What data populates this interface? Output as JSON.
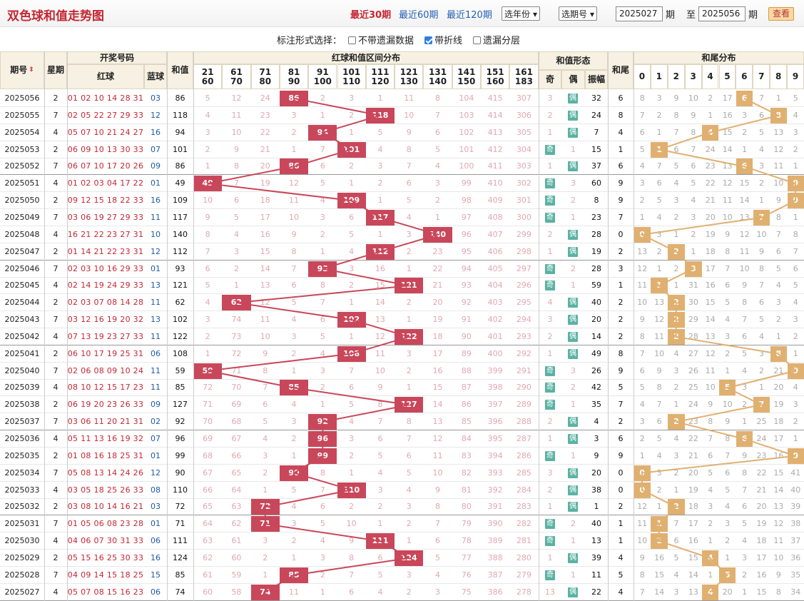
{
  "header": {
    "title": "双色球和值走势图",
    "periods": [
      "最近30期",
      "最近60期",
      "最近120期"
    ],
    "active_period": 0,
    "year_select": "选年份",
    "issue_select": "选期号",
    "from_issue": "2025027",
    "issue_unit": "期",
    "to_label": "至",
    "to_issue": "2025056",
    "query_button": "查看"
  },
  "options": {
    "label": "标注形式选择：",
    "items": [
      {
        "label": "不带遗漏数据",
        "checked": false
      },
      {
        "label": "带折线",
        "checked": true
      },
      {
        "label": "遗漏分层",
        "checked": false
      }
    ]
  },
  "table_header": {
    "period": "期号",
    "week": "星期",
    "draw": "开奖号码",
    "red": "红球",
    "blue": "蓝球",
    "sum": "和值",
    "zone_title": "红球和值区间分布",
    "zones": [
      [
        "21",
        "60"
      ],
      [
        "61",
        "70"
      ],
      [
        "71",
        "80"
      ],
      [
        "81",
        "90"
      ],
      [
        "91",
        "100"
      ],
      [
        "101",
        "110"
      ],
      [
        "111",
        "120"
      ],
      [
        "121",
        "130"
      ],
      [
        "131",
        "140"
      ],
      [
        "141",
        "150"
      ],
      [
        "151",
        "160"
      ],
      [
        "161",
        "183"
      ]
    ],
    "form_title": "和值形态",
    "odd": "奇",
    "even": "偶",
    "amplitude": "振幅",
    "tail_title": "和尾",
    "tail_dist": "和尾分布",
    "tails": [
      "0",
      "1",
      "2",
      "3",
      "4",
      "5",
      "6",
      "7",
      "8",
      "9"
    ]
  },
  "rows": [
    {
      "p": "2025056",
      "w": "2",
      "r": "01 02 10 14 28 31",
      "b": "03",
      "s": "86",
      "zone": 3,
      "zv": [
        "5",
        "12",
        "24",
        "86",
        "2",
        "3",
        "1",
        "11",
        "8",
        "104",
        "415",
        "307"
      ],
      "odd": "3",
      "even": "偶",
      "form": "even",
      "amp": "32",
      "tail": "6",
      "tv": [
        "8",
        "3",
        "9",
        "10",
        "2",
        "17",
        "6",
        "7",
        "1",
        "5"
      ]
    },
    {
      "p": "2025055",
      "w": "7",
      "r": "02 05 22 27 29 33",
      "b": "12",
      "s": "118",
      "zone": 6,
      "zv": [
        "4",
        "11",
        "23",
        "3",
        "1",
        "2",
        "118",
        "10",
        "7",
        "103",
        "414",
        "306"
      ],
      "odd": "2",
      "even": "偶",
      "form": "even",
      "amp": "24",
      "tail": "8",
      "tv": [
        "7",
        "2",
        "8",
        "9",
        "1",
        "16",
        "3",
        "6",
        "8",
        "4"
      ]
    },
    {
      "p": "2025054",
      "w": "4",
      "r": "05 07 10 21 24 27",
      "b": "16",
      "s": "94",
      "zone": 4,
      "zv": [
        "3",
        "10",
        "22",
        "2",
        "94",
        "1",
        "5",
        "9",
        "6",
        "102",
        "413",
        "305"
      ],
      "odd": "1",
      "even": "偶",
      "form": "even",
      "amp": "7",
      "tail": "4",
      "tv": [
        "6",
        "1",
        "7",
        "8",
        "4",
        "15",
        "2",
        "5",
        "13",
        "3"
      ]
    },
    {
      "p": "2025053",
      "w": "2",
      "r": "06 09 10 13 30 33",
      "b": "07",
      "s": "101",
      "zone": 5,
      "zv": [
        "2",
        "9",
        "21",
        "1",
        "7",
        "101",
        "4",
        "8",
        "5",
        "101",
        "412",
        "304"
      ],
      "odd": "奇",
      "even": "1",
      "form": "odd",
      "amp": "15",
      "tail": "1",
      "tv": [
        "5",
        "1",
        "6",
        "7",
        "24",
        "14",
        "1",
        "4",
        "12",
        "2"
      ]
    },
    {
      "p": "2025052",
      "w": "7",
      "r": "06 07 10 17 20 26",
      "b": "09",
      "s": "86",
      "zone": 3,
      "zv": [
        "1",
        "8",
        "20",
        "86",
        "6",
        "2",
        "3",
        "7",
        "4",
        "100",
        "411",
        "303"
      ],
      "odd": "1",
      "even": "偶",
      "form": "even",
      "amp": "37",
      "tail": "6",
      "tv": [
        "4",
        "7",
        "5",
        "6",
        "23",
        "13",
        "6",
        "3",
        "11",
        "1"
      ]
    },
    {
      "p": "2025051",
      "w": "4",
      "r": "01 02 03 04 17 22",
      "b": "01",
      "s": "49",
      "zone": 0,
      "zv": [
        "49",
        "7",
        "19",
        "12",
        "5",
        "1",
        "2",
        "6",
        "3",
        "99",
        "410",
        "302"
      ],
      "odd": "奇",
      "even": "3",
      "form": "odd",
      "amp": "60",
      "tail": "9",
      "tv": [
        "3",
        "6",
        "4",
        "5",
        "22",
        "12",
        "15",
        "2",
        "10",
        "9"
      ]
    },
    {
      "p": "2025050",
      "w": "2",
      "r": "09 12 15 18 22 33",
      "b": "16",
      "s": "109",
      "zone": 5,
      "zv": [
        "10",
        "6",
        "18",
        "11",
        "4",
        "109",
        "1",
        "5",
        "2",
        "98",
        "409",
        "301"
      ],
      "odd": "奇",
      "even": "2",
      "form": "odd",
      "amp": "8",
      "tail": "9",
      "tv": [
        "2",
        "5",
        "3",
        "4",
        "21",
        "11",
        "14",
        "1",
        "9",
        "9"
      ]
    },
    {
      "p": "2025049",
      "w": "7",
      "r": "03 06 19 27 29 33",
      "b": "11",
      "s": "117",
      "zone": 6,
      "zv": [
        "9",
        "5",
        "17",
        "10",
        "3",
        "6",
        "117",
        "4",
        "1",
        "97",
        "408",
        "300"
      ],
      "odd": "奇",
      "even": "1",
      "form": "odd",
      "amp": "23",
      "tail": "7",
      "tv": [
        "1",
        "4",
        "2",
        "3",
        "20",
        "10",
        "13",
        "7",
        "8",
        "1"
      ]
    },
    {
      "p": "2025048",
      "w": "4",
      "r": "16 21 22 23 27 31",
      "b": "10",
      "s": "140",
      "zone": 8,
      "zv": [
        "8",
        "4",
        "16",
        "9",
        "2",
        "5",
        "1",
        "3",
        "140",
        "96",
        "407",
        "299"
      ],
      "odd": "2",
      "even": "偶",
      "form": "even",
      "amp": "28",
      "tail": "0",
      "tv": [
        "0",
        "3",
        "1",
        "2",
        "19",
        "9",
        "12",
        "10",
        "7",
        "8"
      ]
    },
    {
      "p": "2025047",
      "w": "2",
      "r": "01 14 21 22 23 31",
      "b": "12",
      "s": "112",
      "zone": 6,
      "zv": [
        "7",
        "3",
        "15",
        "8",
        "1",
        "4",
        "112",
        "2",
        "23",
        "95",
        "406",
        "298"
      ],
      "odd": "1",
      "even": "偶",
      "form": "even",
      "amp": "19",
      "tail": "2",
      "tv": [
        "13",
        "2",
        "2",
        "1",
        "18",
        "8",
        "11",
        "9",
        "6",
        "7"
      ]
    },
    {
      "p": "2025046",
      "w": "7",
      "r": "02 03 10 16 29 33",
      "b": "01",
      "s": "93",
      "zone": 4,
      "zv": [
        "6",
        "2",
        "14",
        "7",
        "93",
        "3",
        "16",
        "1",
        "22",
        "94",
        "405",
        "297"
      ],
      "odd": "奇",
      "even": "2",
      "form": "odd",
      "amp": "28",
      "tail": "3",
      "tv": [
        "12",
        "1",
        "2",
        "3",
        "17",
        "7",
        "10",
        "8",
        "5",
        "6"
      ]
    },
    {
      "p": "2025045",
      "w": "4",
      "r": "02 14 19 24 29 33",
      "b": "13",
      "s": "121",
      "zone": 7,
      "zv": [
        "5",
        "1",
        "13",
        "6",
        "8",
        "2",
        "15",
        "121",
        "21",
        "93",
        "404",
        "296"
      ],
      "odd": "奇",
      "even": "1",
      "form": "odd",
      "amp": "59",
      "tail": "1",
      "tv": [
        "11",
        "1",
        "1",
        "31",
        "16",
        "6",
        "9",
        "7",
        "4",
        "5"
      ]
    },
    {
      "p": "2025044",
      "w": "2",
      "r": "02 03 07 08 14 28",
      "b": "11",
      "s": "62",
      "zone": 1,
      "zv": [
        "4",
        "62",
        "12",
        "5",
        "7",
        "1",
        "14",
        "2",
        "20",
        "92",
        "403",
        "295"
      ],
      "odd": "4",
      "even": "偶",
      "form": "even",
      "amp": "40",
      "tail": "2",
      "tv": [
        "10",
        "13",
        "2",
        "30",
        "15",
        "5",
        "8",
        "6",
        "3",
        "4"
      ]
    },
    {
      "p": "2025043",
      "w": "7",
      "r": "03 12 16 19 20 32",
      "b": "13",
      "s": "102",
      "zone": 5,
      "zv": [
        "3",
        "74",
        "11",
        "4",
        "6",
        "102",
        "13",
        "1",
        "19",
        "91",
        "402",
        "294"
      ],
      "odd": "3",
      "even": "偶",
      "form": "even",
      "amp": "20",
      "tail": "2",
      "tv": [
        "9",
        "12",
        "2",
        "29",
        "14",
        "4",
        "7",
        "5",
        "2",
        "3"
      ]
    },
    {
      "p": "2025042",
      "w": "4",
      "r": "07 13 19 23 27 33",
      "b": "11",
      "s": "122",
      "zone": 7,
      "zv": [
        "2",
        "73",
        "10",
        "3",
        "5",
        "1",
        "12",
        "122",
        "18",
        "90",
        "401",
        "293"
      ],
      "odd": "2",
      "even": "偶",
      "form": "even",
      "amp": "14",
      "tail": "2",
      "tv": [
        "8",
        "11",
        "2",
        "28",
        "13",
        "3",
        "6",
        "4",
        "1",
        "2"
      ]
    },
    {
      "p": "2025041",
      "w": "2",
      "r": "06 10 17 19 25 31",
      "b": "06",
      "s": "108",
      "zone": 5,
      "zv": [
        "1",
        "72",
        "9",
        "2",
        "4",
        "108",
        "11",
        "3",
        "17",
        "89",
        "400",
        "292"
      ],
      "odd": "1",
      "even": "偶",
      "form": "even",
      "amp": "49",
      "tail": "8",
      "tv": [
        "7",
        "10",
        "4",
        "27",
        "12",
        "2",
        "5",
        "3",
        "8",
        "1"
      ]
    },
    {
      "p": "2025040",
      "w": "7",
      "r": "02 06 08 09 10 24",
      "b": "11",
      "s": "59",
      "zone": 0,
      "zv": [
        "59",
        "71",
        "8",
        "1",
        "3",
        "7",
        "10",
        "2",
        "16",
        "88",
        "399",
        "291"
      ],
      "odd": "奇",
      "even": "3",
      "form": "odd",
      "amp": "26",
      "tail": "9",
      "tv": [
        "6",
        "9",
        "3",
        "26",
        "11",
        "1",
        "4",
        "2",
        "21",
        "9"
      ]
    },
    {
      "p": "2025039",
      "w": "4",
      "r": "08 10 12 15 17 23",
      "b": "11",
      "s": "85",
      "zone": 3,
      "zv": [
        "72",
        "70",
        "7",
        "85",
        "2",
        "6",
        "9",
        "1",
        "15",
        "87",
        "398",
        "290"
      ],
      "odd": "奇",
      "even": "2",
      "form": "odd",
      "amp": "42",
      "tail": "5",
      "tv": [
        "5",
        "8",
        "2",
        "25",
        "10",
        "5",
        "3",
        "1",
        "20",
        "4"
      ]
    },
    {
      "p": "2025038",
      "w": "2",
      "r": "06 19 20 23 26 33",
      "b": "09",
      "s": "127",
      "zone": 7,
      "zv": [
        "71",
        "69",
        "6",
        "4",
        "1",
        "5",
        "8",
        "127",
        "14",
        "86",
        "397",
        "289"
      ],
      "odd": "奇",
      "even": "1",
      "form": "odd",
      "amp": "35",
      "tail": "7",
      "tv": [
        "4",
        "7",
        "1",
        "24",
        "9",
        "10",
        "2",
        "7",
        "19",
        "3"
      ]
    },
    {
      "p": "2025037",
      "w": "7",
      "r": "03 06 11 20 21 31",
      "b": "02",
      "s": "92",
      "zone": 4,
      "zv": [
        "70",
        "68",
        "5",
        "3",
        "92",
        "4",
        "7",
        "8",
        "13",
        "85",
        "396",
        "288"
      ],
      "odd": "2",
      "even": "偶",
      "form": "even",
      "amp": "4",
      "tail": "2",
      "tv": [
        "3",
        "6",
        "2",
        "23",
        "8",
        "9",
        "1",
        "25",
        "18",
        "2"
      ]
    },
    {
      "p": "2025036",
      "w": "4",
      "r": "05 11 13 16 19 32",
      "b": "07",
      "s": "96",
      "zone": 4,
      "zv": [
        "69",
        "67",
        "4",
        "2",
        "96",
        "3",
        "6",
        "7",
        "12",
        "84",
        "395",
        "287"
      ],
      "odd": "1",
      "even": "偶",
      "form": "even",
      "amp": "3",
      "tail": "6",
      "tv": [
        "2",
        "5",
        "4",
        "22",
        "7",
        "8",
        "6",
        "24",
        "17",
        "1"
      ]
    },
    {
      "p": "2025035",
      "w": "2",
      "r": "01 08 16 18 25 31",
      "b": "01",
      "s": "99",
      "zone": 4,
      "zv": [
        "68",
        "66",
        "3",
        "1",
        "99",
        "2",
        "5",
        "6",
        "11",
        "83",
        "394",
        "286"
      ],
      "odd": "奇",
      "even": "1",
      "form": "odd",
      "amp": "9",
      "tail": "9",
      "tv": [
        "1",
        "4",
        "3",
        "21",
        "6",
        "7",
        "9",
        "23",
        "16",
        "9"
      ]
    },
    {
      "p": "2025034",
      "w": "7",
      "r": "05 08 13 14 24 26",
      "b": "12",
      "s": "90",
      "zone": 3,
      "zv": [
        "67",
        "65",
        "2",
        "90",
        "8",
        "1",
        "4",
        "5",
        "10",
        "82",
        "393",
        "285"
      ],
      "odd": "3",
      "even": "偶",
      "form": "even",
      "amp": "20",
      "tail": "0",
      "tv": [
        "0",
        "3",
        "2",
        "20",
        "5",
        "6",
        "8",
        "22",
        "15",
        "41"
      ]
    },
    {
      "p": "2025033",
      "w": "4",
      "r": "03 05 18 25 26 33",
      "b": "08",
      "s": "110",
      "zone": 5,
      "zv": [
        "66",
        "64",
        "1",
        "5",
        "7",
        "110",
        "3",
        "4",
        "9",
        "81",
        "392",
        "284"
      ],
      "odd": "2",
      "even": "偶",
      "form": "even",
      "amp": "38",
      "tail": "0",
      "tv": [
        "0",
        "2",
        "1",
        "19",
        "4",
        "5",
        "7",
        "21",
        "14",
        "40"
      ]
    },
    {
      "p": "2025032",
      "w": "2",
      "r": "03 08 10 14 16 21",
      "b": "03",
      "s": "72",
      "zone": 2,
      "zv": [
        "65",
        "63",
        "72",
        "4",
        "6",
        "2",
        "2",
        "3",
        "8",
        "80",
        "391",
        "283"
      ],
      "odd": "1",
      "even": "偶",
      "form": "even",
      "amp": "1",
      "tail": "2",
      "tv": [
        "12",
        "1",
        "2",
        "18",
        "3",
        "4",
        "6",
        "20",
        "13",
        "39"
      ]
    },
    {
      "p": "2025031",
      "w": "7",
      "r": "01 05 06 08 23 28",
      "b": "01",
      "s": "71",
      "zone": 2,
      "zv": [
        "64",
        "62",
        "71",
        "3",
        "5",
        "10",
        "1",
        "2",
        "7",
        "79",
        "390",
        "282"
      ],
      "odd": "奇",
      "even": "2",
      "form": "odd",
      "amp": "40",
      "tail": "1",
      "tv": [
        "11",
        "1",
        "7",
        "17",
        "2",
        "3",
        "5",
        "19",
        "12",
        "38"
      ]
    },
    {
      "p": "2025030",
      "w": "4",
      "r": "04 06 07 30 31 33",
      "b": "06",
      "s": "111",
      "zone": 6,
      "zv": [
        "63",
        "61",
        "3",
        "2",
        "4",
        "9",
        "111",
        "1",
        "6",
        "78",
        "389",
        "281"
      ],
      "odd": "奇",
      "even": "1",
      "form": "odd",
      "amp": "13",
      "tail": "1",
      "tv": [
        "10",
        "1",
        "6",
        "16",
        "1",
        "2",
        "4",
        "18",
        "11",
        "37"
      ]
    },
    {
      "p": "2025029",
      "w": "2",
      "r": "05 15 16 25 30 33",
      "b": "16",
      "s": "124",
      "zone": 7,
      "zv": [
        "62",
        "60",
        "2",
        "1",
        "3",
        "8",
        "6",
        "124",
        "5",
        "77",
        "388",
        "280"
      ],
      "odd": "1",
      "even": "偶",
      "form": "even",
      "amp": "39",
      "tail": "4",
      "tv": [
        "9",
        "16",
        "5",
        "15",
        "4",
        "1",
        "3",
        "17",
        "10",
        "36"
      ]
    },
    {
      "p": "2025028",
      "w": "7",
      "r": "04 09 14 15 18 25",
      "b": "15",
      "s": "85",
      "zone": 3,
      "zv": [
        "61",
        "59",
        "1",
        "85",
        "2",
        "7",
        "5",
        "3",
        "4",
        "76",
        "387",
        "279"
      ],
      "odd": "奇",
      "even": "1",
      "form": "odd",
      "amp": "11",
      "tail": "5",
      "tv": [
        "8",
        "15",
        "4",
        "14",
        "1",
        "5",
        "2",
        "16",
        "9",
        "35"
      ]
    },
    {
      "p": "2025027",
      "w": "4",
      "r": "05 07 08 15 16 23",
      "b": "06",
      "s": "74",
      "zone": 2,
      "zv": [
        "60",
        "58",
        "74",
        "11",
        "1",
        "6",
        "4",
        "2",
        "3",
        "75",
        "386",
        "278"
      ],
      "odd": "13",
      "even": "偶",
      "form": "even",
      "amp": "22",
      "tail": "4",
      "tv": [
        "7",
        "14",
        "3",
        "13",
        "4",
        "20",
        "1",
        "15",
        "8",
        "34"
      ]
    }
  ],
  "colors": {
    "sum_highlight": "#c9475a",
    "tail_highlight": "#e0b070",
    "form_badge": "#5ab2a2",
    "sum_line": "#c9475a",
    "tail_line": "#e0b070"
  }
}
